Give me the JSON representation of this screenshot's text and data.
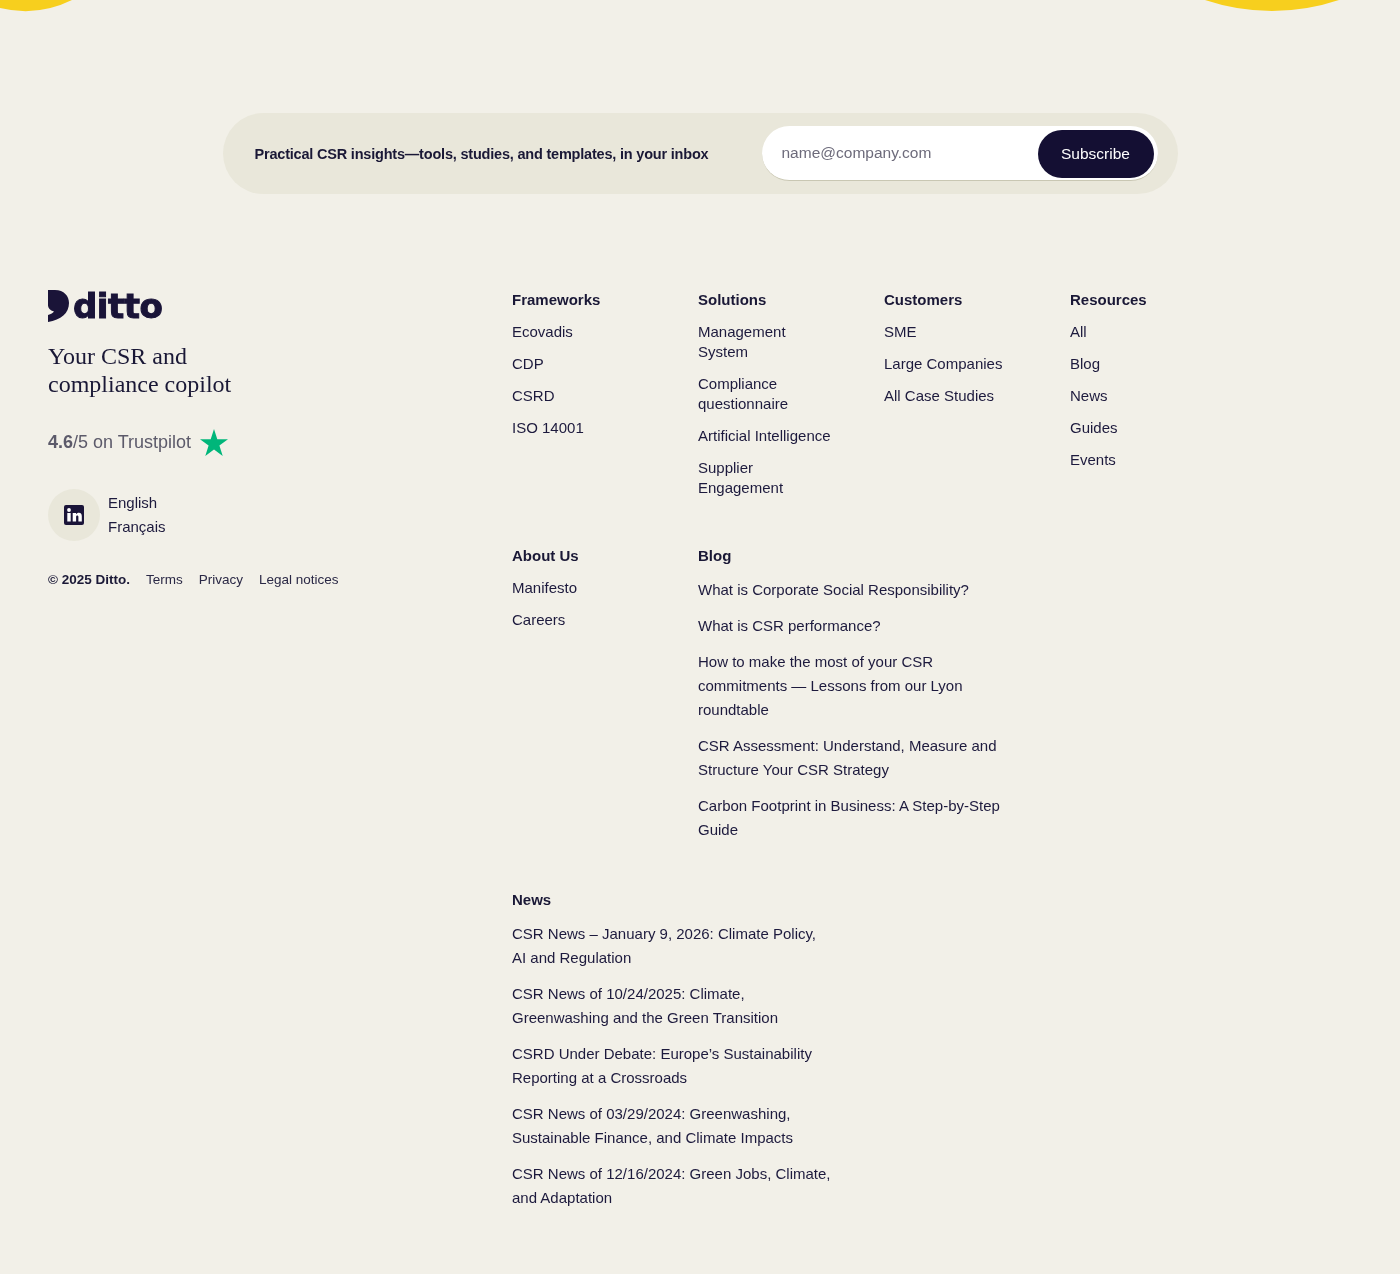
{
  "newsletter": {
    "text": "Practical CSR insights—tools, studies, and templates, in your inbox",
    "placeholder": "name@company.com",
    "button": "Subscribe"
  },
  "brand": {
    "logo": "ditto",
    "tagline": "Your CSR and compliance copilot",
    "rating": "**4.6**/5 on Trustpilot"
  },
  "languages": [
    "English",
    "Français"
  ],
  "legal": {
    "copyright": "© 2025 Ditto.",
    "links": [
      "Terms",
      "Privacy",
      "Legal notices"
    ]
  },
  "nav_sections": [
    {
      "kind": "links",
      "heading": "Frameworks",
      "links": [
        "Ecovadis",
        "CDP",
        "CSRD",
        "ISO 14001"
      ]
    },
    {
      "kind": "links",
      "heading": "Solutions",
      "links": [
        "Management System",
        "Compliance questionnaire",
        "Artificial Intelligence",
        "Supplier Engagement"
      ]
    },
    {
      "kind": "links",
      "heading": "Customers",
      "links": [
        "SME",
        "Large Companies",
        "All Case Studies"
      ]
    },
    {
      "kind": "links",
      "heading": "Resources",
      "links": [
        "All",
        "Blog",
        "News",
        "Guides",
        "Events"
      ]
    },
    {
      "kind": "links",
      "heading": "About Us",
      "links": [
        "Manifesto",
        "Careers"
      ]
    },
    {
      "kind": "articles",
      "heading": "Blog",
      "links": [
        "What is Corporate Social Responsibility?",
        "What is CSR performance?",
        "How to make the most of your CSR commitments — Lessons from our Lyon roundtable",
        "CSR Assessment: Understand, Measure and Structure Your CSR Strategy",
        "Carbon Footprint in Business: A Step-by-Step Guide"
      ]
    },
    {
      "kind": "articles",
      "heading": "News",
      "links": [
        "CSR News – January 9, 2026: Climate Policy, AI and Regulation",
        "CSR News of 10/24/2025: Climate, Greenwashing and the Green Transition",
        "CSRD Under Debate: Europe’s Sustainability Reporting at a Crossroads",
        "CSR News of 03/29/2024: Greenwashing, Sustainable Finance, and Climate Impacts",
        "CSR News of 12/16/2024: Green Jobs, Climate, and Adaptation"
      ]
    }
  ]
}
